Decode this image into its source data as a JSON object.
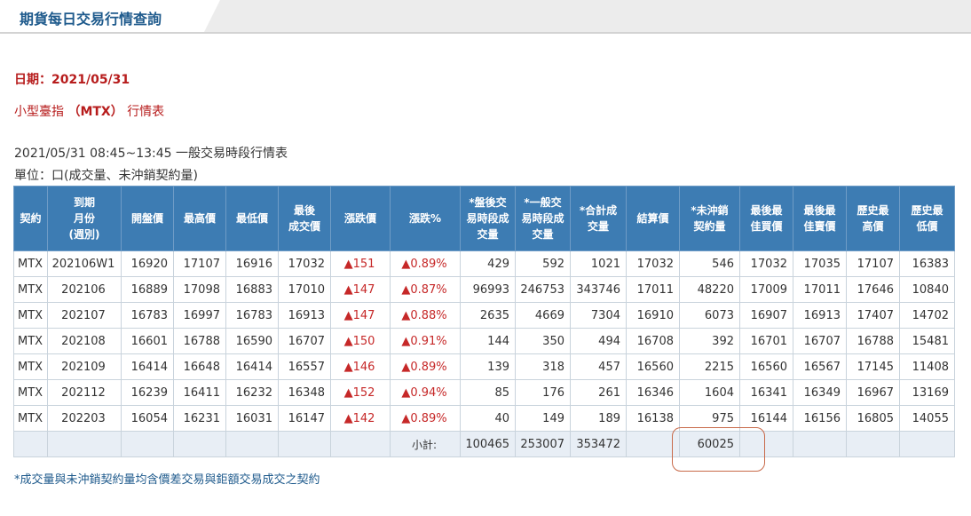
{
  "tab": {
    "title": "期貨每日交易行情查詢"
  },
  "date_label": "日期：2021/05/31",
  "product": {
    "name": "小型臺指",
    "code": "（MTX）",
    "suffix": "行情表"
  },
  "session": "2021/05/31  08:45~13:45 一般交易時段行情表",
  "unit": "單位：口(成交量、未沖銷契約量)",
  "headers": [
    "契約",
    "到期\n月份\n(週別)",
    "開盤價",
    "最高價",
    "最低價",
    "最後\n成交價",
    "漲跌價",
    "漲跌%",
    "*盤後交\n易時段成\n交量",
    "*一般交\n易時段成\n交量",
    "*合計成\n交量",
    "結算價",
    "*未沖銷\n契約量",
    "最後最\n佳買價",
    "最後最\n佳賣價",
    "歷史最\n高價",
    "歷史最\n低價"
  ],
  "rows": [
    [
      "MTX",
      "202106W1",
      "16920",
      "17107",
      "16916",
      "17032",
      "▲151",
      "▲0.89%",
      "429",
      "592",
      "1021",
      "17032",
      "546",
      "17032",
      "17035",
      "17107",
      "16383"
    ],
    [
      "MTX",
      "202106",
      "16889",
      "17098",
      "16883",
      "17010",
      "▲147",
      "▲0.87%",
      "96993",
      "246753",
      "343746",
      "17011",
      "48220",
      "17009",
      "17011",
      "17646",
      "10840"
    ],
    [
      "MTX",
      "202107",
      "16783",
      "16997",
      "16783",
      "16913",
      "▲147",
      "▲0.88%",
      "2635",
      "4669",
      "7304",
      "16910",
      "6073",
      "16907",
      "16913",
      "17407",
      "14702"
    ],
    [
      "MTX",
      "202108",
      "16601",
      "16788",
      "16590",
      "16707",
      "▲150",
      "▲0.91%",
      "144",
      "350",
      "494",
      "16708",
      "392",
      "16701",
      "16707",
      "16788",
      "15481"
    ],
    [
      "MTX",
      "202109",
      "16414",
      "16648",
      "16414",
      "16557",
      "▲146",
      "▲0.89%",
      "139",
      "318",
      "457",
      "16560",
      "2215",
      "16560",
      "16567",
      "17145",
      "11408"
    ],
    [
      "MTX",
      "202112",
      "16239",
      "16411",
      "16232",
      "16348",
      "▲152",
      "▲0.94%",
      "85",
      "176",
      "261",
      "16346",
      "1604",
      "16341",
      "16349",
      "16967",
      "13169"
    ],
    [
      "MTX",
      "202203",
      "16054",
      "16231",
      "16031",
      "16147",
      "▲142",
      "▲0.89%",
      "40",
      "149",
      "189",
      "16138",
      "975",
      "16144",
      "16156",
      "16805",
      "14055"
    ]
  ],
  "summary": {
    "label": "小計:",
    "after_hours": "100465",
    "regular": "253007",
    "total": "353472",
    "open_interest": "60025"
  },
  "footnote": "*成交量與未沖銷契約量均含價差交易與鉅額交易成交之契約",
  "colors": {
    "header_bg": "#3d7cb3",
    "title_red": "#b71c1c",
    "up_red": "#c62828",
    "tab_text": "#1e5a8c",
    "highlight": "#c86a4a"
  }
}
